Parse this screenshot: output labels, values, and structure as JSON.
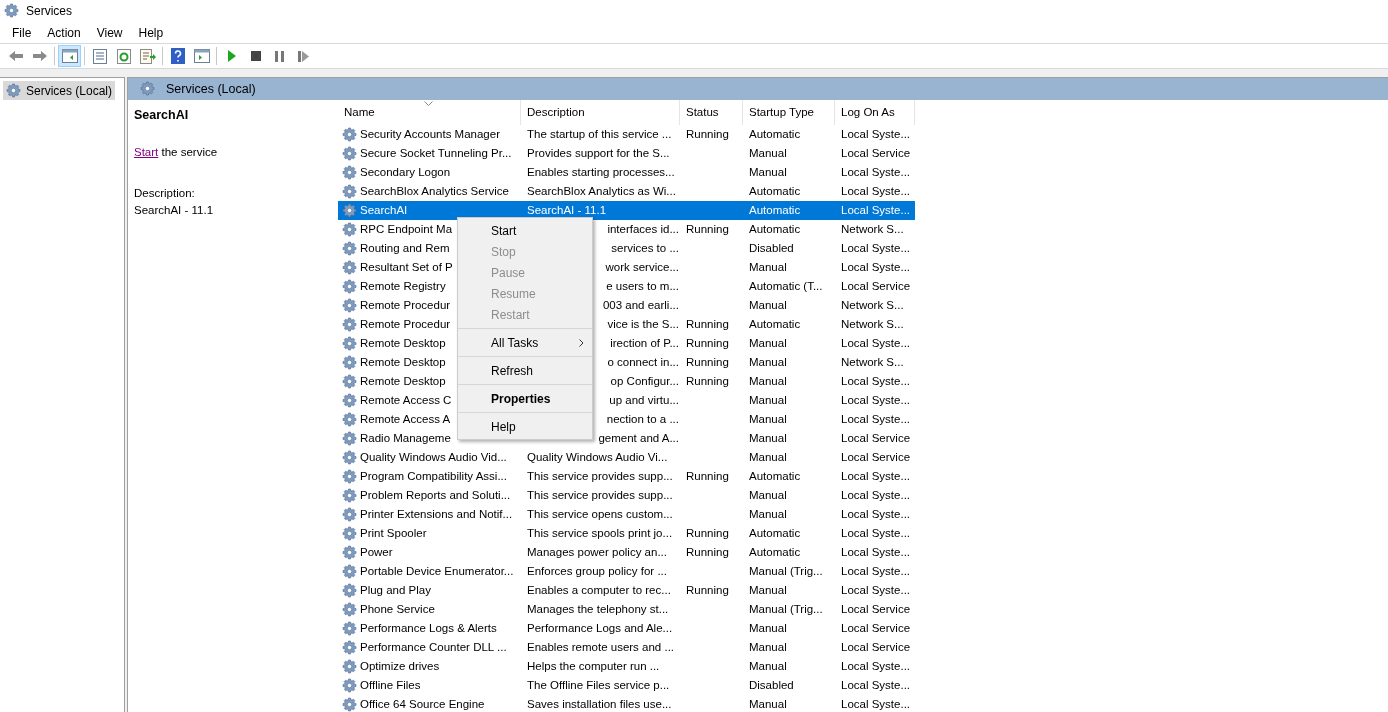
{
  "window": {
    "title": "Services"
  },
  "menu_bar": [
    "File",
    "Action",
    "View",
    "Help"
  ],
  "toolbar": {
    "show_tree_pressed": true
  },
  "tree": {
    "items": [
      {
        "label": "Services (Local)",
        "selected": true
      }
    ]
  },
  "panel": {
    "title": "Services (Local)"
  },
  "details": {
    "service_name": "SearchAI",
    "action_link": "Start",
    "action_text": "the service",
    "description_label": "Description:",
    "description": "SearchAI - 11.1"
  },
  "table": {
    "columns": [
      {
        "label": "Name",
        "sorted": true
      },
      {
        "label": "Description",
        "sorted": false
      },
      {
        "label": "Status",
        "sorted": false
      },
      {
        "label": "Startup Type",
        "sorted": false
      },
      {
        "label": "Log On As",
        "sorted": false
      }
    ],
    "rows": [
      {
        "name": "Security Accounts Manager",
        "description": "The startup of this service ...",
        "status": "Running",
        "startup_type": "Automatic",
        "log_on_as": "Local Syste...",
        "selected": false,
        "covered": false
      },
      {
        "name": "Secure Socket Tunneling Pr...",
        "description": "Provides support for the S...",
        "status": "",
        "startup_type": "Manual",
        "log_on_as": "Local Service",
        "selected": false,
        "covered": false
      },
      {
        "name": "Secondary Logon",
        "description": "Enables starting processes...",
        "status": "",
        "startup_type": "Manual",
        "log_on_as": "Local Syste...",
        "selected": false,
        "covered": false
      },
      {
        "name": "SearchBlox Analytics Service",
        "description": "SearchBlox Analytics as Wi...",
        "status": "",
        "startup_type": "Automatic",
        "log_on_as": "Local Syste...",
        "selected": false,
        "covered": false
      },
      {
        "name": "SearchAI",
        "description": "SearchAI - 11.1",
        "status": "",
        "startup_type": "Automatic",
        "log_on_as": "Local Syste...",
        "selected": true,
        "covered": false
      },
      {
        "name": "RPC Endpoint Ma",
        "description": "interfaces id...",
        "status": "Running",
        "startup_type": "Automatic",
        "log_on_as": "Network S...",
        "selected": false,
        "covered": true
      },
      {
        "name": "Routing and Rem",
        "description": "services to ...",
        "status": "",
        "startup_type": "Disabled",
        "log_on_as": "Local Syste...",
        "selected": false,
        "covered": true
      },
      {
        "name": "Resultant Set of P",
        "description": "work service...",
        "status": "",
        "startup_type": "Manual",
        "log_on_as": "Local Syste...",
        "selected": false,
        "covered": true
      },
      {
        "name": "Remote Registry",
        "description": "e users to m...",
        "status": "",
        "startup_type": "Automatic (T...",
        "log_on_as": "Local Service",
        "selected": false,
        "covered": true
      },
      {
        "name": "Remote Procedur",
        "description": "003 and earli...",
        "status": "",
        "startup_type": "Manual",
        "log_on_as": "Network S...",
        "selected": false,
        "covered": true
      },
      {
        "name": "Remote Procedur",
        "description": "vice is the S...",
        "status": "Running",
        "startup_type": "Automatic",
        "log_on_as": "Network S...",
        "selected": false,
        "covered": true
      },
      {
        "name": "Remote Desktop",
        "description": "irection of P...",
        "status": "Running",
        "startup_type": "Manual",
        "log_on_as": "Local Syste...",
        "selected": false,
        "covered": true
      },
      {
        "name": "Remote Desktop",
        "description": "o connect in...",
        "status": "Running",
        "startup_type": "Manual",
        "log_on_as": "Network S...",
        "selected": false,
        "covered": true
      },
      {
        "name": "Remote Desktop",
        "description": "op Configur...",
        "status": "Running",
        "startup_type": "Manual",
        "log_on_as": "Local Syste...",
        "selected": false,
        "covered": true
      },
      {
        "name": "Remote Access C",
        "description": "up and virtu...",
        "status": "",
        "startup_type": "Manual",
        "log_on_as": "Local Syste...",
        "selected": false,
        "covered": true
      },
      {
        "name": "Remote Access A",
        "description": "nection to a ...",
        "status": "",
        "startup_type": "Manual",
        "log_on_as": "Local Syste...",
        "selected": false,
        "covered": true
      },
      {
        "name": "Radio Manageme",
        "description": "gement and A...",
        "status": "",
        "startup_type": "Manual",
        "log_on_as": "Local Service",
        "selected": false,
        "covered": true
      },
      {
        "name": "Quality Windows Audio Vid...",
        "description": "Quality Windows Audio Vi...",
        "status": "",
        "startup_type": "Manual",
        "log_on_as": "Local Service",
        "selected": false,
        "covered": false
      },
      {
        "name": "Program Compatibility Assi...",
        "description": "This service provides supp...",
        "status": "Running",
        "startup_type": "Automatic",
        "log_on_as": "Local Syste...",
        "selected": false,
        "covered": false
      },
      {
        "name": "Problem Reports and Soluti...",
        "description": "This service provides supp...",
        "status": "",
        "startup_type": "Manual",
        "log_on_as": "Local Syste...",
        "selected": false,
        "covered": false
      },
      {
        "name": "Printer Extensions and Notif...",
        "description": "This service opens custom...",
        "status": "",
        "startup_type": "Manual",
        "log_on_as": "Local Syste...",
        "selected": false,
        "covered": false
      },
      {
        "name": "Print Spooler",
        "description": "This service spools print jo...",
        "status": "Running",
        "startup_type": "Automatic",
        "log_on_as": "Local Syste...",
        "selected": false,
        "covered": false
      },
      {
        "name": "Power",
        "description": "Manages power policy an...",
        "status": "Running",
        "startup_type": "Automatic",
        "log_on_as": "Local Syste...",
        "selected": false,
        "covered": false
      },
      {
        "name": "Portable Device Enumerator...",
        "description": "Enforces group policy for ...",
        "status": "",
        "startup_type": "Manual (Trig...",
        "log_on_as": "Local Syste...",
        "selected": false,
        "covered": false
      },
      {
        "name": "Plug and Play",
        "description": "Enables a computer to rec...",
        "status": "Running",
        "startup_type": "Manual",
        "log_on_as": "Local Syste...",
        "selected": false,
        "covered": false
      },
      {
        "name": "Phone Service",
        "description": "Manages the telephony st...",
        "status": "",
        "startup_type": "Manual (Trig...",
        "log_on_as": "Local Service",
        "selected": false,
        "covered": false
      },
      {
        "name": "Performance Logs & Alerts",
        "description": "Performance Logs and Ale...",
        "status": "",
        "startup_type": "Manual",
        "log_on_as": "Local Service",
        "selected": false,
        "covered": false
      },
      {
        "name": "Performance Counter DLL ...",
        "description": "Enables remote users and ...",
        "status": "",
        "startup_type": "Manual",
        "log_on_as": "Local Service",
        "selected": false,
        "covered": false
      },
      {
        "name": "Optimize drives",
        "description": "Helps the computer run ...",
        "status": "",
        "startup_type": "Manual",
        "log_on_as": "Local Syste...",
        "selected": false,
        "covered": false
      },
      {
        "name": "Offline Files",
        "description": "The Offline Files service p...",
        "status": "",
        "startup_type": "Disabled",
        "log_on_as": "Local Syste...",
        "selected": false,
        "covered": false
      },
      {
        "name": "Office 64 Source Engine",
        "description": "Saves installation files use...",
        "status": "",
        "startup_type": "Manual",
        "log_on_as": "Local Syste...",
        "selected": false,
        "covered": false
      }
    ]
  },
  "context_menu": {
    "items": [
      {
        "label": "Start",
        "disabled": false,
        "default": false,
        "submenu": false,
        "separator_before": false
      },
      {
        "label": "Stop",
        "disabled": true,
        "default": false,
        "submenu": false,
        "separator_before": false
      },
      {
        "label": "Pause",
        "disabled": true,
        "default": false,
        "submenu": false,
        "separator_before": false
      },
      {
        "label": "Resume",
        "disabled": true,
        "default": false,
        "submenu": false,
        "separator_before": false
      },
      {
        "label": "Restart",
        "disabled": true,
        "default": false,
        "submenu": false,
        "separator_before": false
      },
      {
        "label": "All Tasks",
        "disabled": false,
        "default": false,
        "submenu": true,
        "separator_before": true
      },
      {
        "label": "Refresh",
        "disabled": false,
        "default": false,
        "submenu": false,
        "separator_before": true
      },
      {
        "label": "Properties",
        "disabled": false,
        "default": true,
        "submenu": false,
        "separator_before": true
      },
      {
        "label": "Help",
        "disabled": false,
        "default": false,
        "submenu": false,
        "separator_before": true
      }
    ]
  }
}
